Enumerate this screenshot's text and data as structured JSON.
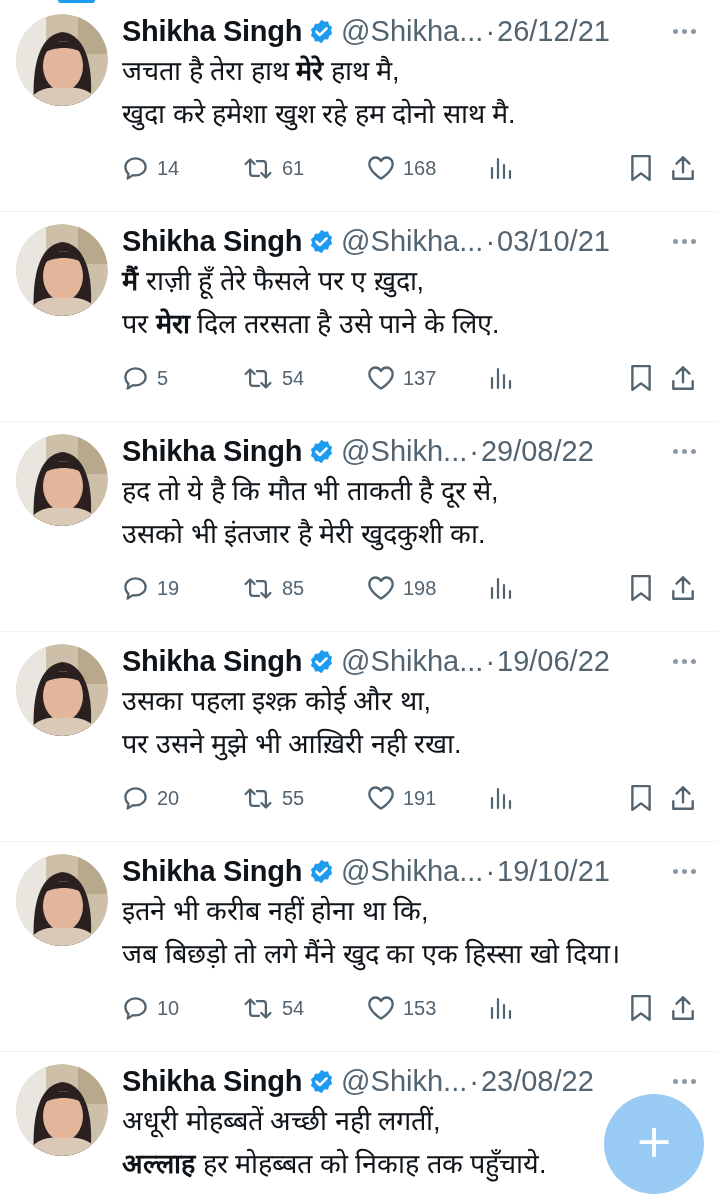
{
  "tweets": [
    {
      "name": "Shikha Singh",
      "verified": true,
      "handle": "@Shikha...",
      "separator": "·",
      "date": "26/12/21",
      "text_lines": [
        "जचता है तेरा हाथ **मेरे** हाथ मै,",
        "खुदा करे हमेशा खुश रहे हम दोनो साथ मै."
      ],
      "replies": "14",
      "retweets": "61",
      "likes": "168"
    },
    {
      "name": "Shikha Singh",
      "verified": true,
      "handle": "@Shikha...",
      "separator": "·",
      "date": "03/10/21",
      "text_lines": [
        "**मैं** राज़ी हूँ तेरे फैसले पर ए ख़ुदा,",
        "पर **मेरा** दिल तरसता है उसे पाने के लिए."
      ],
      "replies": "5",
      "retweets": "54",
      "likes": "137"
    },
    {
      "name": "Shikha Singh",
      "verified": true,
      "handle": "@Shikh...",
      "separator": "·",
      "date": "29/08/22",
      "text_lines": [
        "हद तो ये है कि मौत भी ताकती है दूर से,",
        "उसको भी इंतजार है मेरी खुदकुशी का."
      ],
      "replies": "19",
      "retweets": "85",
      "likes": "198"
    },
    {
      "name": "Shikha Singh",
      "verified": true,
      "handle": "@Shikha...",
      "separator": "·",
      "date": "19/06/22",
      "text_lines": [
        "उसका पहला इश्क़ कोई और था,",
        "पर उसने मुझे भी आख़िरी नही रखा."
      ],
      "replies": "20",
      "retweets": "55",
      "likes": "191"
    },
    {
      "name": "Shikha Singh",
      "verified": true,
      "handle": "@Shikha...",
      "separator": "·",
      "date": "19/10/21",
      "text_lines": [
        "इतने भी करीब नहीं होना था कि,",
        "जब बिछड़ो तो लगे मैंने खुद का एक हिस्सा खो दिया।"
      ],
      "replies": "10",
      "retweets": "54",
      "likes": "153"
    },
    {
      "name": "Shikha Singh",
      "verified": true,
      "handle": "@Shikh...",
      "separator": "·",
      "date": "23/08/22",
      "text_lines": [
        "अधूरी मोहब्बतें अच्छी नही लगतीं,",
        "**अल्लाह** हर मोहब्बत को निकाह तक पहुँचाये."
      ]
    }
  ],
  "compose_button": {
    "label": "+"
  }
}
